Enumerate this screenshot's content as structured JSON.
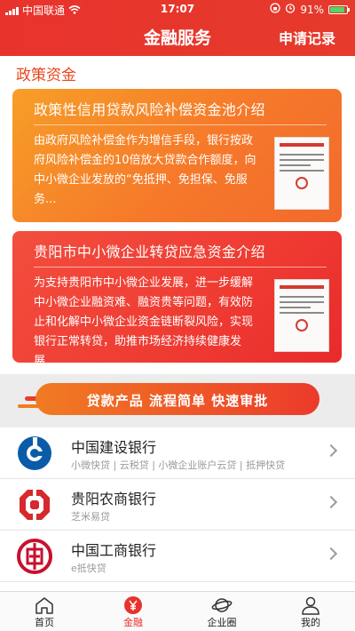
{
  "status_bar": {
    "carrier": "中国联通",
    "time": "17:07",
    "battery": "91%",
    "battery_level": 0.91
  },
  "nav": {
    "title": "金融服务",
    "right_action": "申请记录"
  },
  "section": {
    "title": "政策资金"
  },
  "cards": [
    {
      "title": "政策性信用贷款风险补偿资金池介绍",
      "description": "由政府风险补偿金作为增信手段，银行按政府风险补偿金的10倍放大贷款合作额度，向中小微企业发放的“免抵押、免担保、免服务...",
      "doc_icon": "document-icon"
    },
    {
      "title": "贵阳市中小微企业转贷应急资金介绍",
      "description": "为支持贵阳市中小微企业发展，进一步缓解中小微企业融资难、融资贵等问题，有效防止和化解中小微企业资金链断裂风险，实现银行正常转贷，助推市场经济持续健康发展......",
      "doc_icon": "document-icon"
    }
  ],
  "banner": {
    "text": "贷款产品  流程简单  快速审批"
  },
  "banks": [
    {
      "name": "中国建设银行",
      "tags": "小微快贷 | 云税贷 | 小微企业账户云贷 | 抵押快贷",
      "icon": "ccb-logo-icon"
    },
    {
      "name": "贵阳农商银行",
      "tags": "芝米易贷",
      "icon": "rural-bank-logo-icon"
    },
    {
      "name": "中国工商银行",
      "tags": "e抵快贷",
      "icon": "icbc-logo-icon"
    }
  ],
  "tabs": [
    {
      "label": "首页",
      "icon": "home-icon",
      "active": false
    },
    {
      "label": "金融",
      "icon": "finance-icon",
      "active": true
    },
    {
      "label": "企业圈",
      "icon": "planet-icon",
      "active": false
    },
    {
      "label": "我的",
      "icon": "user-icon",
      "active": false
    }
  ],
  "colors": {
    "brand_red": "#e8332d",
    "card_orange": "#f6792a",
    "card_red": "#ef3b32",
    "section_title": "#e8471c"
  }
}
